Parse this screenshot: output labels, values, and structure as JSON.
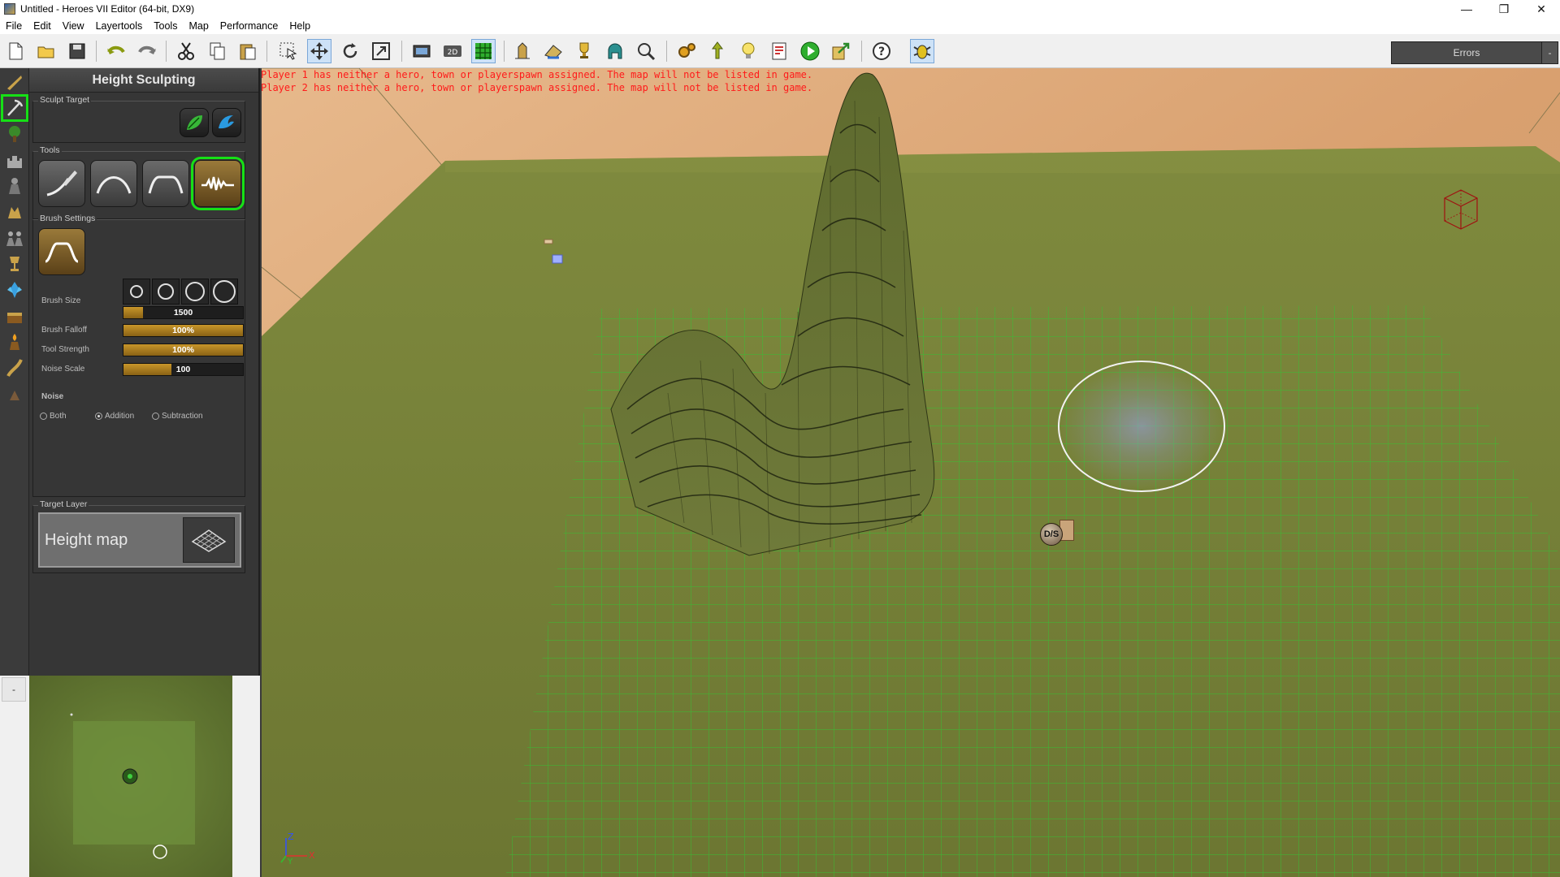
{
  "window": {
    "title": "Untitled - Heroes VII Editor (64-bit, DX9)",
    "controls": [
      "—",
      "❐",
      "✕"
    ]
  },
  "menu": [
    "File",
    "Edit",
    "View",
    "Layertools",
    "Tools",
    "Map",
    "Performance",
    "Help"
  ],
  "toolbar": {
    "errors_label": "Errors",
    "errors_dropdown": "-"
  },
  "panel": {
    "title": "Height Sculpting",
    "sculpt_target_label": "Sculpt Target",
    "tools_label": "Tools",
    "brush_settings_label": "Brush Settings",
    "brush_size_label": "Brush Size",
    "brush_size_value": "1500",
    "brush_size_fraction": 0.16,
    "brush_falloff_label": "Brush Falloff",
    "brush_falloff_value": "100%",
    "brush_falloff_fraction": 1.0,
    "tool_strength_label": "Tool Strength",
    "tool_strength_value": "100%",
    "tool_strength_fraction": 1.0,
    "noise_scale_label": "Noise Scale",
    "noise_scale_value": "100",
    "noise_scale_fraction": 0.4,
    "noise_label": "Noise",
    "noise_options": [
      "Both",
      "Addition",
      "Subtraction"
    ],
    "noise_selected": "Addition",
    "target_layer_label": "Target Layer",
    "target_layer_value": "Height map"
  },
  "messages": [
    "Player 1 has neither a hero, town or playerspawn assigned. The map will not be listed in game.",
    "Player 2 has neither a hero, town or playerspawn assigned. The map will not be listed in game."
  ],
  "scene": {
    "spawn_label": "D/S",
    "axis_z": "Z",
    "axis_x": "X",
    "axis_y": "Y"
  },
  "minimap": {
    "toggle_label": "-"
  },
  "colors": {
    "accent_green": "#16e016",
    "slider_gold": "#c8962a",
    "error_red": "#ff1a1a",
    "terrain": "#6b7a33"
  }
}
